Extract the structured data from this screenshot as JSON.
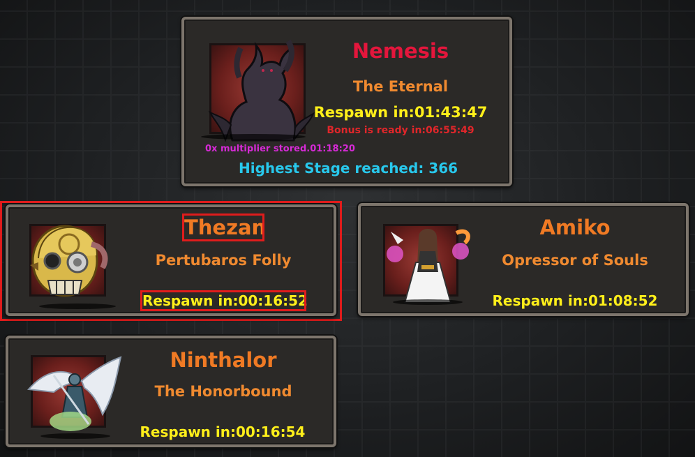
{
  "bosses": [
    {
      "name": "Nemesis",
      "name_color": "#e4163c",
      "subtitle": "The Eternal",
      "respawn": "Respawn in:01:43:47",
      "bonus": "Bonus is ready in:06:55:49",
      "multiplier": "0x multiplier stored.01:18:20",
      "highest_stage": "Highest Stage reached: 366"
    },
    {
      "name": "Thezan",
      "subtitle": "Pertubaros Folly",
      "respawn": "Respawn in:00:16:52",
      "highlighted": true
    },
    {
      "name": "Amiko",
      "subtitle": "Opressor of Souls",
      "respawn": "Respawn in:01:08:52"
    },
    {
      "name": "Ninthalor",
      "subtitle": "The Honorbound",
      "respawn": "Respawn in:00:16:54"
    }
  ],
  "icons": [
    "nemesis-portrait",
    "thezan-portrait",
    "amiko-portrait",
    "ninthalor-portrait"
  ],
  "colors": {
    "name": "#f07a24",
    "respawn": "#ffef1a",
    "bonus": "#e0262a",
    "multiplier": "#d62ad6",
    "highest_stage": "#28c8ec",
    "highlight": "#e01c1c"
  }
}
